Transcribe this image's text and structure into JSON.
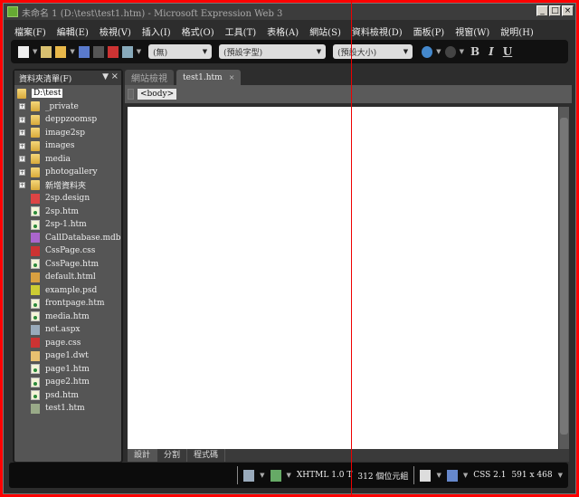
{
  "window": {
    "title": "未命名 1 (D:\\test\\test1.htm) - Microsoft Expression Web 3",
    "controls": [
      "_",
      "□",
      "×"
    ]
  },
  "menu": [
    "檔案(F)",
    "編輯(E)",
    "檢視(V)",
    "插入(I)",
    "格式(O)",
    "工具(T)",
    "表格(A)",
    "網站(S)",
    "資料檢視(D)",
    "面板(P)",
    "視窗(W)",
    "說明(H)"
  ],
  "toolbar": {
    "style": "(無)",
    "font": "(預設字型)",
    "size": "(預設大小)",
    "bold": "B",
    "italic": "I",
    "underline": "U"
  },
  "panel": {
    "title": "資料夾清單(F)",
    "pin": "▼",
    "close": "×",
    "root": "D:\\test",
    "folders": [
      "_private",
      "deppzoomsp",
      "image2sp",
      "images",
      "media",
      "photogallery",
      "新增資料夾"
    ],
    "files": [
      {
        "name": "2sp.design",
        "icon": "design-file-icon"
      },
      {
        "name": "2sp.htm",
        "icon": "html-file-icon"
      },
      {
        "name": "2sp-1.htm",
        "icon": "html-file-icon"
      },
      {
        "name": "CallDatabase.mdb",
        "icon": "database-file-icon"
      },
      {
        "name": "CssPage.css",
        "icon": "css-file-icon"
      },
      {
        "name": "CssPage.htm",
        "icon": "html-file-icon"
      },
      {
        "name": "default.html",
        "icon": "home-page-icon"
      },
      {
        "name": "example.psd",
        "icon": "psd-file-icon"
      },
      {
        "name": "frontpage.htm",
        "icon": "html-file-icon"
      },
      {
        "name": "media.htm",
        "icon": "html-file-icon"
      },
      {
        "name": "net.aspx",
        "icon": "aspx-file-icon"
      },
      {
        "name": "page.css",
        "icon": "css-file-icon"
      },
      {
        "name": "page1.dwt",
        "icon": "template-file-icon"
      },
      {
        "name": "page1.htm",
        "icon": "html-file-icon"
      },
      {
        "name": "page2.htm",
        "icon": "html-file-icon"
      },
      {
        "name": "psd.htm",
        "icon": "html-file-icon"
      },
      {
        "name": "test1.htm",
        "icon": "html-edit-file-icon"
      }
    ]
  },
  "editor": {
    "tabs": [
      {
        "label": "網站檢視"
      },
      {
        "label": "test1.htm",
        "close": "×"
      }
    ],
    "breadcrumb": "<body>",
    "view_tabs": [
      "設計",
      "分割",
      "程式碼"
    ]
  },
  "status": {
    "doctype": "XHTML 1.0 T",
    "size": "312 個位元組",
    "css": "CSS 2.1",
    "dimensions": "591 x 468"
  }
}
